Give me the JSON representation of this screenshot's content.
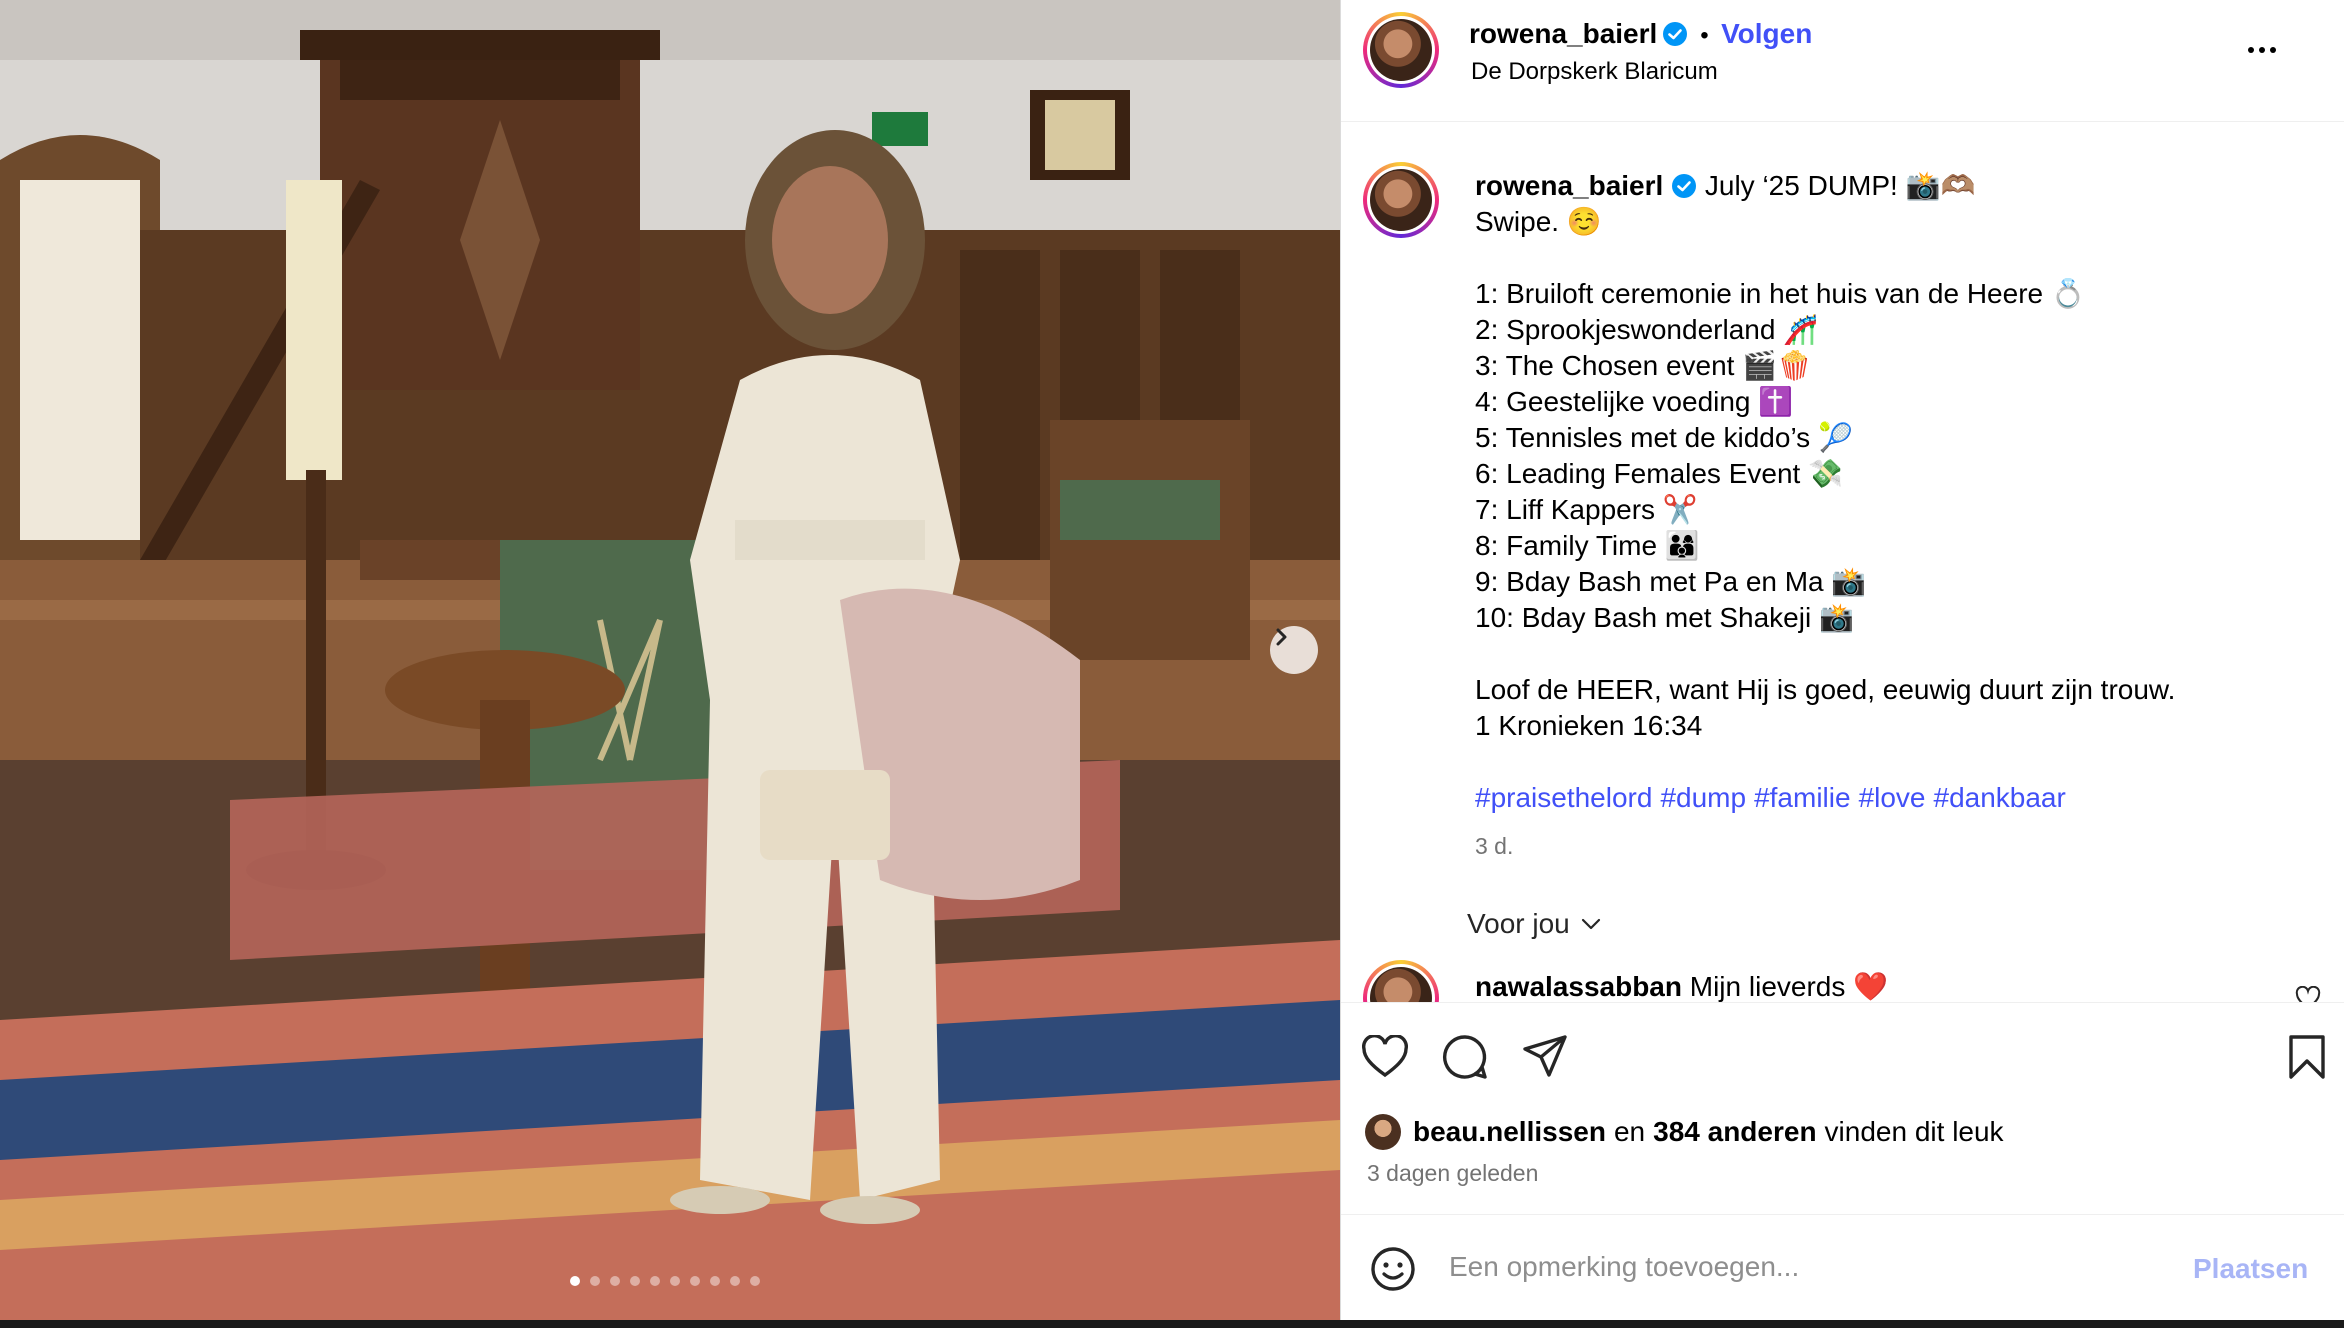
{
  "header": {
    "username": "rowena_baierl",
    "separator": "•",
    "follow_label": "Volgen",
    "location": "De Dorpskerk Blaricum"
  },
  "caption": {
    "username": "rowena_baierl",
    "title": "July ‘25 DUMP! 📸🫶🏽",
    "lines": [
      "Swipe. ☺️",
      "",
      "1: Bruiloft ceremonie in het huis van de Heere 💍",
      "2: Sprookjeswonderland 🎢",
      "3: The Chosen event 🎬🍿",
      "4: Geestelijke voeding ✝️",
      "5: Tennisles met de kiddo’s 🎾",
      "6: Leading Females Event 💸",
      "7: Liff Kappers ✂️",
      "8: Family Time 👨‍👩‍👦",
      "9: Bday Bash met Pa en Ma 📸",
      "10: Bday Bash met Shakeji 📸",
      "",
      "Loof de HEER, want Hij is goed, eeuwig duurt zijn trouw.",
      "1 Kronieken 16:34"
    ],
    "hashtags": [
      "#praisethelord",
      "#dump",
      "#familie",
      "#love",
      "#dankbaar"
    ],
    "time": "3 d."
  },
  "for_you": {
    "label": "Voor jou"
  },
  "comment": {
    "username": "nawalassabban",
    "text": "Mijn lieverds ❤️"
  },
  "likes": {
    "first_user": "beau.nellissen",
    "connector": "en",
    "count_text": "384 anderen",
    "suffix": "vinden dit leuk"
  },
  "ago": "3 dagen geleden",
  "comment_box": {
    "placeholder": "Een opmerking toevoegen...",
    "post_label": "Plaatsen"
  },
  "carousel": {
    "total_slides": 10,
    "active_slide": 1
  },
  "colors": {
    "accent": "#4150f7",
    "muted": "#737373",
    "post_disabled": "#a8b5f6",
    "verified": "#0095f6"
  },
  "icons": [
    "verified-icon",
    "more-icon",
    "chevron-right-icon",
    "chevron-down-icon",
    "heart-icon",
    "comment-icon",
    "share-icon",
    "bookmark-icon",
    "emoji-icon"
  ]
}
